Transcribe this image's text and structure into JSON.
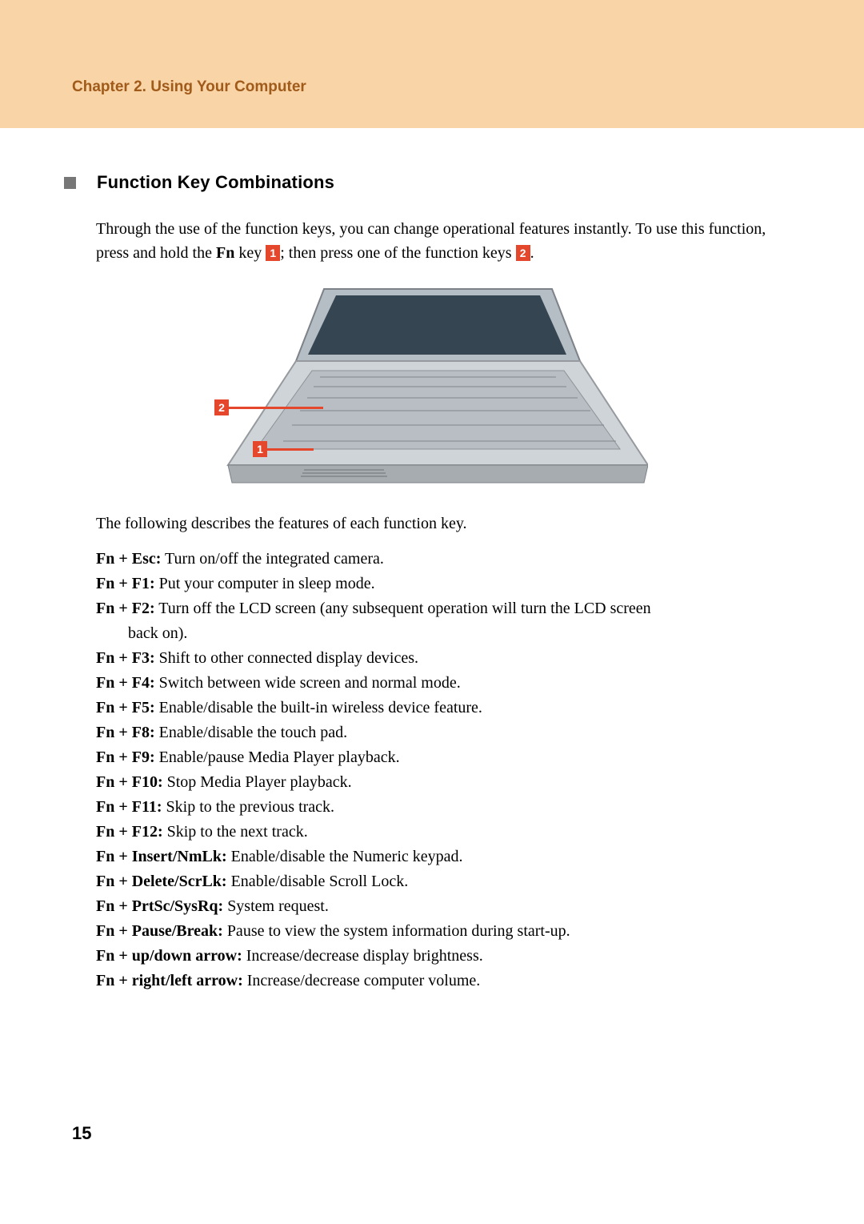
{
  "header": {
    "chapter_title": "Chapter 2. Using Your Computer"
  },
  "section": {
    "title": "Function Key Combinations",
    "intro_1": "Through the use of the function keys, you can change operational features instantly. To use this function, press and hold the ",
    "fn_label": "Fn",
    "intro_2": " key ",
    "marker1": "1",
    "intro_3": "; then press one of the function keys ",
    "marker2": "2",
    "intro_4": ".",
    "desc_line": "The following describes the features of each function key."
  },
  "callouts": {
    "one": "1",
    "two": "2"
  },
  "fn_keys": [
    {
      "key": "Fn + Esc:",
      "desc": " Turn on/off the integrated camera."
    },
    {
      "key": "Fn + F1:",
      "desc": " Put your computer in sleep mode."
    },
    {
      "key": "Fn + F2:",
      "desc": " Turn off the LCD screen (any subsequent operation will turn the LCD screen",
      "cont": "back on)."
    },
    {
      "key": "Fn + F3:",
      "desc": " Shift to other connected display devices."
    },
    {
      "key": "Fn + F4:",
      "desc": " Switch between wide screen and normal mode."
    },
    {
      "key": "Fn + F5:",
      "desc": " Enable/disable the built-in wireless device feature."
    },
    {
      "key": "Fn + F8:",
      "desc": " Enable/disable the touch pad."
    },
    {
      "key": "Fn + F9:",
      "desc": " Enable/pause Media Player playback."
    },
    {
      "key": "Fn + F10:",
      "desc": " Stop Media Player playback."
    },
    {
      "key": "Fn + F11:",
      "desc": " Skip to the previous track."
    },
    {
      "key": "Fn + F12:",
      "desc": " Skip to the next track."
    },
    {
      "key": "Fn + Insert/NmLk:",
      "desc": " Enable/disable the Numeric keypad."
    },
    {
      "key": "Fn + Delete/ScrLk:",
      "desc": " Enable/disable Scroll Lock."
    },
    {
      "key": "Fn + PrtSc/SysRq:",
      "desc": " System request."
    },
    {
      "key": "Fn + Pause/Break:",
      "desc": " Pause to view the system information during start-up."
    },
    {
      "key": "Fn + up/down arrow:",
      "desc": " Increase/decrease display brightness."
    },
    {
      "key": "Fn + right/left arrow:",
      "desc": " Increase/decrease computer volume."
    }
  ],
  "page_number": "15"
}
